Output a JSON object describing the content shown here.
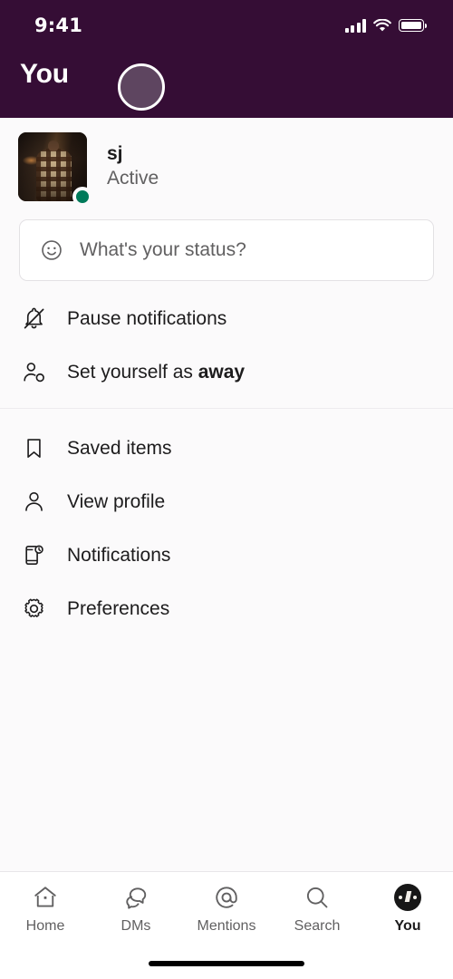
{
  "status_bar": {
    "time": "9:41",
    "signal_icon": "cellular-signal-icon",
    "wifi_icon": "wifi-icon",
    "battery_icon": "battery-icon"
  },
  "header": {
    "title": "You",
    "background_color": "#350d35",
    "avatar_icon": "workspace-avatar"
  },
  "profile": {
    "name": "sj",
    "presence": "Active",
    "presence_color": "#007a5a",
    "avatar_icon": "user-avatar-photo"
  },
  "status_input": {
    "emoji_icon": "smiley-icon",
    "placeholder": "What's your status?",
    "value": ""
  },
  "menu_groups": [
    {
      "items": [
        {
          "icon": "bell-slash-icon",
          "label": "Pause notifications",
          "label_prefix": "Pause notifications",
          "label_bold": ""
        },
        {
          "icon": "person-clock-icon",
          "label": "Set yourself as away",
          "label_prefix": "Set yourself as ",
          "label_bold": "away"
        }
      ]
    },
    {
      "items": [
        {
          "icon": "bookmark-icon",
          "label": "Saved items",
          "label_prefix": "Saved items",
          "label_bold": ""
        },
        {
          "icon": "person-icon",
          "label": "View profile",
          "label_prefix": "View profile",
          "label_bold": ""
        },
        {
          "icon": "phone-bell-icon",
          "label": "Notifications",
          "label_prefix": "Notifications",
          "label_bold": ""
        },
        {
          "icon": "gear-icon",
          "label": "Preferences",
          "label_prefix": "Preferences",
          "label_bold": ""
        }
      ]
    }
  ],
  "tabbar": {
    "tabs": [
      {
        "icon": "home-icon",
        "label": "Home",
        "active": false
      },
      {
        "icon": "chat-bubbles-icon",
        "label": "DMs",
        "active": false
      },
      {
        "icon": "at-sign-icon",
        "label": "Mentions",
        "active": false
      },
      {
        "icon": "search-icon",
        "label": "Search",
        "active": false
      },
      {
        "icon": "user-avatar-icon",
        "label": "You",
        "active": true
      }
    ],
    "active_color": "#1d1c1d",
    "inactive_color": "#616061"
  },
  "home_indicator": "home-indicator"
}
